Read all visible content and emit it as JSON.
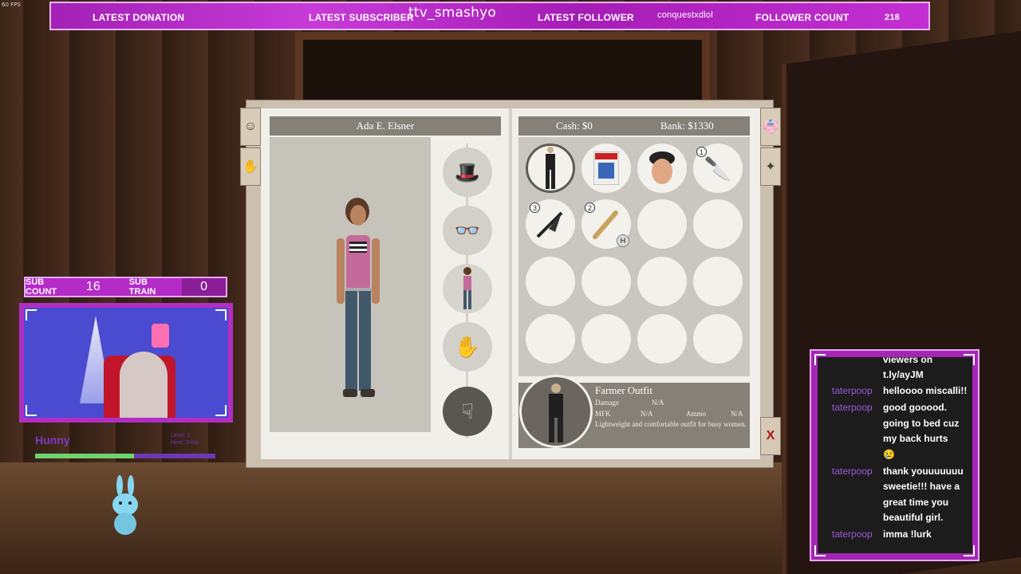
{
  "fps": "60 FPS",
  "topbar": {
    "donation_label": "LATEST DONATION",
    "subscriber_label": "LATEST SUBSCRIBER",
    "subscriber_value": "ttv_smashyo",
    "follower_label": "LATEST FOLLOWER",
    "follower_value": "conquestxdlol",
    "count_label": "FOLLOWER COUNT",
    "count_value": "218"
  },
  "subs": {
    "count_label": "SUB COUNT",
    "count_value": "16",
    "train_label": "SUB TRAIN",
    "train_value": "0"
  },
  "pet": {
    "name": "Hunny",
    "level_line1": "Level: 2",
    "level_line2": "Next: 0/4xp",
    "xp_fraction": 0.55
  },
  "inventory": {
    "character_name": "Ada E. Elsner",
    "cash": "Cash: $0",
    "bank": "Bank: $1330",
    "badges": {
      "knife": "1",
      "umbrella": "3",
      "bat": "2",
      "hotkey": "H"
    },
    "detail": {
      "title": "Farmer Outfit",
      "damage_label": "Damage",
      "damage_value": "N/A",
      "mfk_label": "MFK",
      "mfk_value": "N/A",
      "ammo_label": "Ammo",
      "ammo_value": "N/A",
      "description": "Lightweight and comfortable outfit for busy women."
    },
    "close_label": "X"
  },
  "chat": {
    "pre_line1": "viewers on",
    "pre_line2": "t.ly/ayJM",
    "messages": [
      {
        "user": "taterpoop",
        "lines": [
          "helloooo miscalli!!"
        ]
      },
      {
        "user": "taterpoop",
        "lines": [
          "good gooood.",
          "going to bed cuz",
          "my back hurts",
          "😢"
        ]
      },
      {
        "user": "taterpoop",
        "lines": [
          "thank youuuuuuu",
          "sweetie!!! have a",
          "great time you",
          "beautiful girl."
        ]
      },
      {
        "user": "taterpoop",
        "lines": [
          "imma !lurk"
        ]
      }
    ]
  }
}
